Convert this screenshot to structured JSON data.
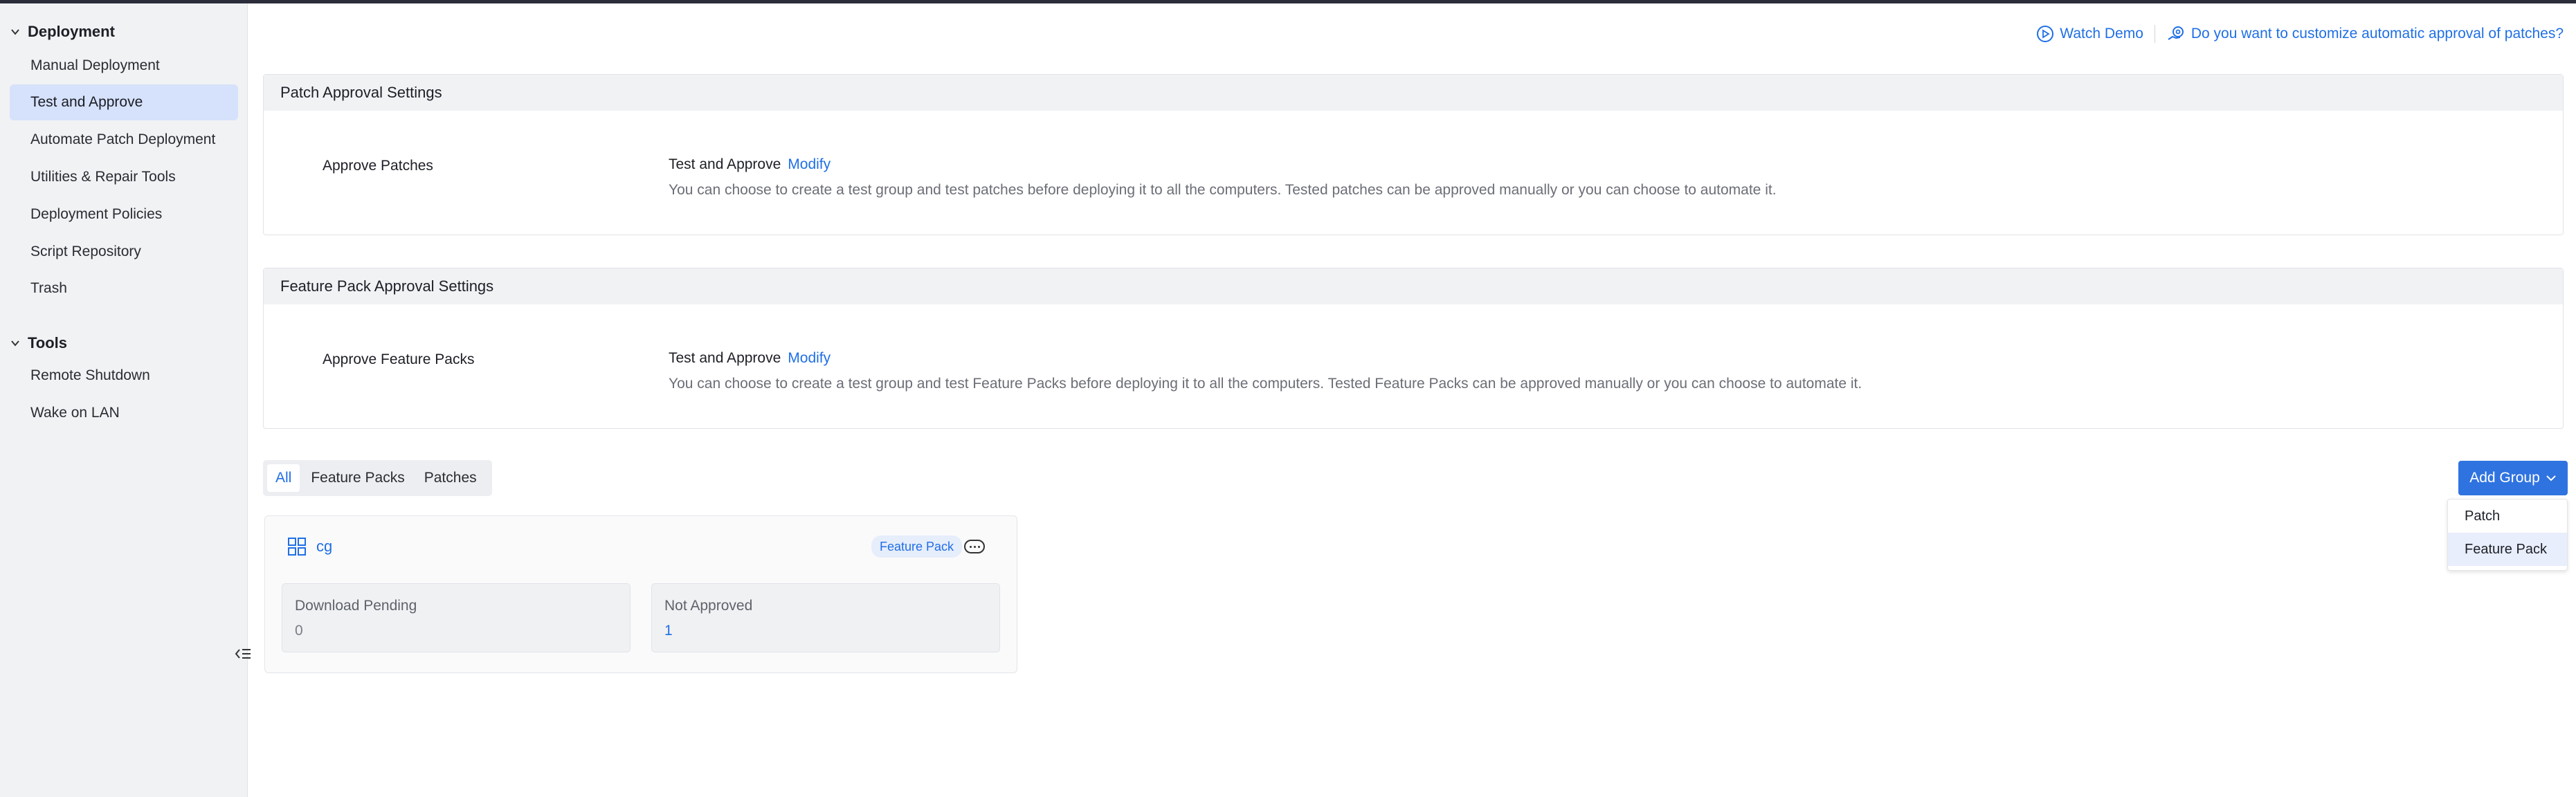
{
  "sidebar": {
    "deployment": {
      "title": "Deployment",
      "items": [
        {
          "label": "Manual Deployment"
        },
        {
          "label": "Test and Approve",
          "active": true
        },
        {
          "label": "Automate Patch Deployment"
        },
        {
          "label": "Utilities & Repair Tools"
        },
        {
          "label": "Deployment Policies"
        },
        {
          "label": "Script Repository"
        },
        {
          "label": "Trash"
        }
      ]
    },
    "tools": {
      "title": "Tools",
      "items": [
        {
          "label": "Remote Shutdown"
        },
        {
          "label": "Wake on LAN"
        }
      ]
    }
  },
  "header": {
    "watch_demo": "Watch Demo",
    "customize_link": "Do you want to customize automatic approval of patches?"
  },
  "patch_panel": {
    "title": "Patch Approval Settings",
    "label": "Approve Patches",
    "value": "Test and Approve",
    "modify": "Modify",
    "description": "You can choose to create a test group and test patches before deploying it to all the computers. Tested patches can be approved manually or you can choose to automate it."
  },
  "feature_panel": {
    "title": "Feature Pack Approval Settings",
    "label": "Approve Feature Packs",
    "value": "Test and Approve",
    "modify": "Modify",
    "description": "You can choose to create a test group and test Feature Packs before deploying it to all the computers. Tested Feature Packs can be approved manually or you can choose to automate it."
  },
  "tabs": [
    {
      "label": "All",
      "active": true
    },
    {
      "label": "Feature Packs"
    },
    {
      "label": "Patches"
    }
  ],
  "add_group": {
    "label": "Add Group",
    "options": [
      {
        "label": "Patch"
      },
      {
        "label": "Feature Pack",
        "highlighted": true
      }
    ]
  },
  "group_card": {
    "name": "cg",
    "badge": "Feature Pack",
    "stats": [
      {
        "label": "Download Pending",
        "value": "0"
      },
      {
        "label": "Not Approved",
        "value": "1"
      }
    ]
  },
  "colors": {
    "accent": "#1f6fe5",
    "button": "#2f73e0",
    "active_nav": "#d6e2fb",
    "sidebar_bg": "#f1f2f4"
  }
}
